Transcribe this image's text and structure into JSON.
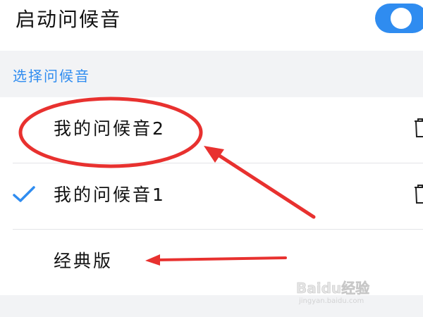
{
  "header": {
    "toggle_label": "启动问候音",
    "toggle_on": true
  },
  "section": {
    "title": "选择问候音"
  },
  "list": {
    "items": [
      {
        "label": "我的问候音2",
        "selected": false,
        "deletable": true
      },
      {
        "label": "我的问候音1",
        "selected": true,
        "deletable": true
      },
      {
        "label": "经典版",
        "selected": false,
        "deletable": false
      }
    ]
  },
  "icons": {
    "check": "check-icon",
    "trash": "trash-icon"
  },
  "colors": {
    "accent": "#2f8cf0",
    "annotation": "#e8312f",
    "background": "#f2f3f5",
    "surface": "#ffffff"
  },
  "watermark": {
    "text": "Baidu经验",
    "subtext": "jingyan.baidu.com"
  }
}
